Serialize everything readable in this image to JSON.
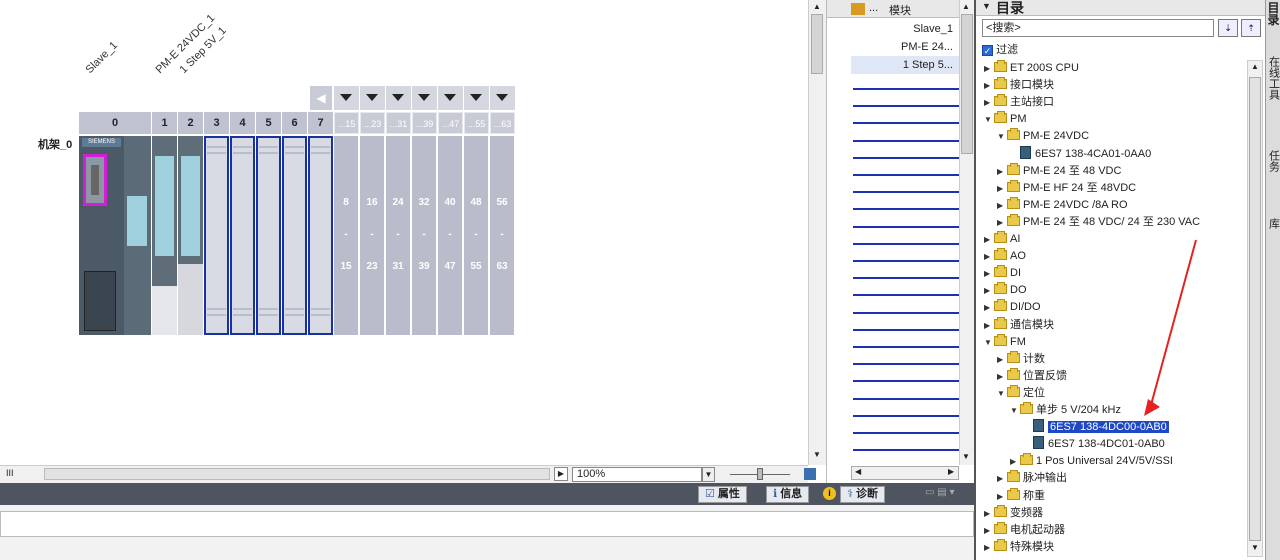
{
  "device_view": {
    "rack_label": "机架_0",
    "device_labels": [
      "Slave_1",
      "PM-E 24VDC_1",
      "1 Step 5V_1"
    ],
    "slot_numbers": [
      "0",
      "1",
      "2",
      "3",
      "4",
      "5",
      "6",
      "7"
    ],
    "range_headers": [
      "...15",
      "...23",
      "...31",
      "...39",
      "...47",
      "...55",
      "...63"
    ],
    "range_start": [
      "8",
      "16",
      "24",
      "32",
      "40",
      "48",
      "56"
    ],
    "range_dash": [
      "-",
      "-",
      "-",
      "-",
      "-",
      "-",
      "-"
    ],
    "range_end": [
      "15",
      "23",
      "31",
      "39",
      "47",
      "55",
      "63"
    ],
    "head_module_brand": "SIEMENS",
    "zoom": "100%"
  },
  "overview_table": {
    "column_module": "模块",
    "column_dots": "...",
    "rows": [
      "Slave_1",
      "PM-E 24...",
      "1 Step 5..."
    ]
  },
  "bottom_tabs": {
    "properties": "属性",
    "info": "信息",
    "diagnostics": "诊断"
  },
  "catalog": {
    "title": "目录",
    "search_placeholder": "<搜索>",
    "filter_label": "过滤",
    "tree": [
      {
        "label": "ET 200S CPU",
        "indent": 0,
        "toggle": "▶",
        "type": "folder"
      },
      {
        "label": "接口模块",
        "indent": 0,
        "toggle": "▶",
        "type": "folder"
      },
      {
        "label": "主站接口",
        "indent": 0,
        "toggle": "▶",
        "type": "folder"
      },
      {
        "label": "PM",
        "indent": 0,
        "toggle": "▼",
        "type": "folder"
      },
      {
        "label": "PM-E 24VDC",
        "indent": 1,
        "toggle": "▼",
        "type": "folder"
      },
      {
        "label": "6ES7 138-4CA01-0AA0",
        "indent": 2,
        "toggle": "",
        "type": "module"
      },
      {
        "label": "PM-E 24 至 48 VDC",
        "indent": 1,
        "toggle": "▶",
        "type": "folder"
      },
      {
        "label": "PM-E HF 24 至 48VDC",
        "indent": 1,
        "toggle": "▶",
        "type": "folder"
      },
      {
        "label": "PM-E 24VDC /8A RO",
        "indent": 1,
        "toggle": "▶",
        "type": "folder"
      },
      {
        "label": "PM-E 24 至 48 VDC/ 24 至 230 VAC",
        "indent": 1,
        "toggle": "▶",
        "type": "folder"
      },
      {
        "label": "AI",
        "indent": 0,
        "toggle": "▶",
        "type": "folder"
      },
      {
        "label": "AO",
        "indent": 0,
        "toggle": "▶",
        "type": "folder"
      },
      {
        "label": "DI",
        "indent": 0,
        "toggle": "▶",
        "type": "folder"
      },
      {
        "label": "DO",
        "indent": 0,
        "toggle": "▶",
        "type": "folder"
      },
      {
        "label": "DI/DO",
        "indent": 0,
        "toggle": "▶",
        "type": "folder"
      },
      {
        "label": "通信模块",
        "indent": 0,
        "toggle": "▶",
        "type": "folder"
      },
      {
        "label": "FM",
        "indent": 0,
        "toggle": "▼",
        "type": "folder"
      },
      {
        "label": "计数",
        "indent": 1,
        "toggle": "▶",
        "type": "folder"
      },
      {
        "label": "位置反馈",
        "indent": 1,
        "toggle": "▶",
        "type": "folder"
      },
      {
        "label": "定位",
        "indent": 1,
        "toggle": "▼",
        "type": "folder"
      },
      {
        "label": "单步 5 V/204 kHz",
        "indent": 2,
        "toggle": "▼",
        "type": "folder"
      },
      {
        "label": "6ES7 138-4DC00-0AB0",
        "indent": 3,
        "toggle": "",
        "type": "module",
        "selected": true
      },
      {
        "label": "6ES7 138-4DC01-0AB0",
        "indent": 3,
        "toggle": "",
        "type": "module"
      },
      {
        "label": "1 Pos Universal 24V/5V/SSI",
        "indent": 2,
        "toggle": "▶",
        "type": "folder"
      },
      {
        "label": "脉冲输出",
        "indent": 1,
        "toggle": "▶",
        "type": "folder"
      },
      {
        "label": "称重",
        "indent": 1,
        "toggle": "▶",
        "type": "folder"
      },
      {
        "label": "变频器",
        "indent": 0,
        "toggle": "▶",
        "type": "folder"
      },
      {
        "label": "电机起动器",
        "indent": 0,
        "toggle": "▶",
        "type": "folder"
      },
      {
        "label": "特殊模块",
        "indent": 0,
        "toggle": "▶",
        "type": "folder"
      }
    ]
  },
  "right_rail": {
    "tab_online": "在线工具",
    "tab_tasks": "任务",
    "tab_library": "库"
  },
  "colors": {
    "selection": "#1f48c6",
    "slot_outline": "#1730a6",
    "annotation_arrow": "#e8201f"
  }
}
